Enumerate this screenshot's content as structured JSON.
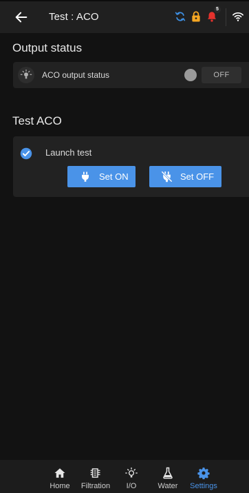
{
  "header": {
    "title": "Test : ACO",
    "notification_count": "5",
    "icons": [
      "back-arrow-icon",
      "sync-icon",
      "lock-icon",
      "bell-icon",
      "wifi-icon"
    ]
  },
  "output_status": {
    "section_title": "Output status",
    "label": "ACO output status",
    "state": "OFF"
  },
  "test_aco": {
    "section_title": "Test ACO",
    "launch_label": "Launch test",
    "set_on_label": "Set ON",
    "set_off_label": "Set OFF"
  },
  "nav": {
    "items": [
      {
        "label": "Home",
        "icon": "home-icon"
      },
      {
        "label": "Filtration",
        "icon": "filtration-icon"
      },
      {
        "label": "I/O",
        "icon": "bulb-icon"
      },
      {
        "label": "Water",
        "icon": "flask-icon"
      },
      {
        "label": "Settings",
        "icon": "gear-icon"
      }
    ],
    "active": "Settings"
  },
  "colors": {
    "accent": "#4a93e8",
    "background": "#121212",
    "card": "#222222",
    "lock": "#f5a623",
    "bell": "#e5322d"
  }
}
